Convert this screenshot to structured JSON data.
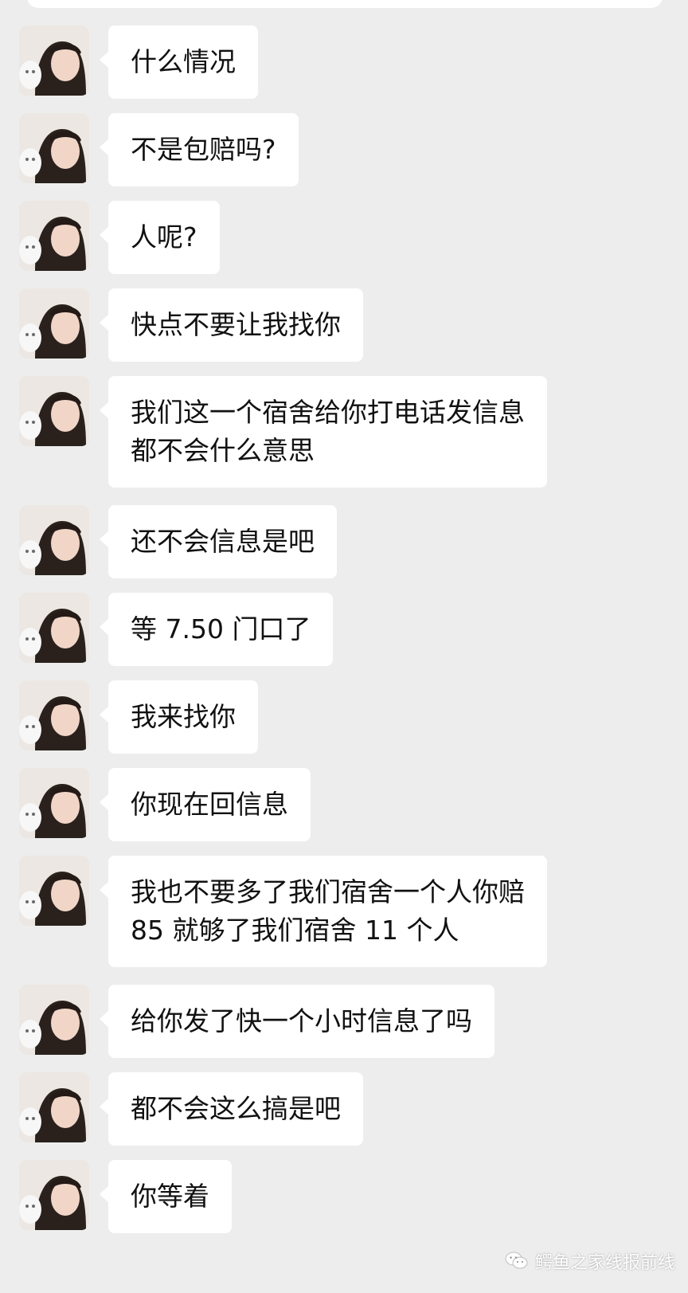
{
  "messages": [
    {
      "text": "什么情况"
    },
    {
      "text": "不是包赔吗?"
    },
    {
      "text": "人呢?"
    },
    {
      "text": "快点不要让我找你"
    },
    {
      "text": "我们这一个宿舍给你打电话发信息\n都不会什么意思"
    },
    {
      "text": "还不会信息是吧"
    },
    {
      "text": "等 7.50 门口了"
    },
    {
      "text": "我来找你"
    },
    {
      "text": "你现在回信息"
    },
    {
      "text": "我也不要多了我们宿舍一个人你赔\n85 就够了我们宿舍 11 个人"
    },
    {
      "text": "给你发了快一个小时信息了吗"
    },
    {
      "text": "都不会这么搞是吧"
    },
    {
      "text": "你等着"
    }
  ],
  "watermark": {
    "text": "鳄鱼之家线报前线",
    "icon": "wechat-icon"
  },
  "colors": {
    "background": "#ededed",
    "bubble": "#ffffff",
    "text": "#111111"
  }
}
